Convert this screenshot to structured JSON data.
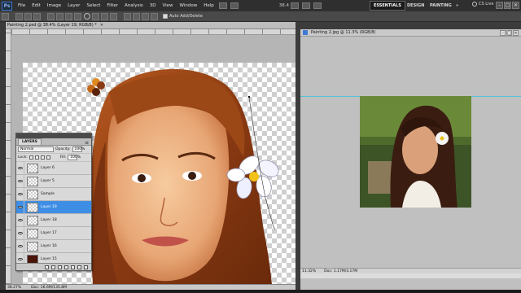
{
  "menubar": {
    "logo": "Ps",
    "items": [
      "File",
      "Edit",
      "Image",
      "Layer",
      "Select",
      "Filter",
      "Analysis",
      "3D",
      "View",
      "Window",
      "Help"
    ],
    "zoom": "38.4",
    "workspaces": [
      "ESSENTIALS",
      "DESIGN",
      "PAINTING",
      "»"
    ],
    "cs_live": "CS Live",
    "window_controls": [
      "–",
      "□",
      "✕"
    ]
  },
  "options_bar": {
    "auto_add_delete": "Auto Add/Delete"
  },
  "doc1": {
    "tab_title": "Painting 2.psd @ 38.4% (Layer 19, RGB/8) *",
    "zoom": "38.27%",
    "doc_size": "Doc: 16.6M/135.8M"
  },
  "doc2": {
    "tab_title": "Painting 2.jpg @ 11.3% (RGB/8)",
    "zoom": "11.32%",
    "doc_size": "Doc: 1.17M/3.17M"
  },
  "layers": {
    "tab": "LAYERS",
    "menu": "≡",
    "blend_mode": "Normal",
    "opacity_label": "Opacity:",
    "opacity_value": "100%",
    "lock_label": "Lock:",
    "fill_label": "Fill:",
    "fill_value": "100%",
    "items": [
      {
        "name": "Layer 6",
        "selected": false
      },
      {
        "name": "Layer 5",
        "selected": false
      },
      {
        "name": "Sample",
        "selected": false
      },
      {
        "name": "Layer 19",
        "selected": true
      },
      {
        "name": "Layer 18",
        "selected": false
      },
      {
        "name": "Layer 17",
        "selected": false
      },
      {
        "name": "Layer 16",
        "selected": false
      },
      {
        "name": "Layer 15",
        "selected": false
      }
    ]
  },
  "colors": {
    "accent": "#3f8ee6",
    "hair": "#8a3a12",
    "skin": "#f0b88a",
    "guide": "#52c5d6"
  }
}
